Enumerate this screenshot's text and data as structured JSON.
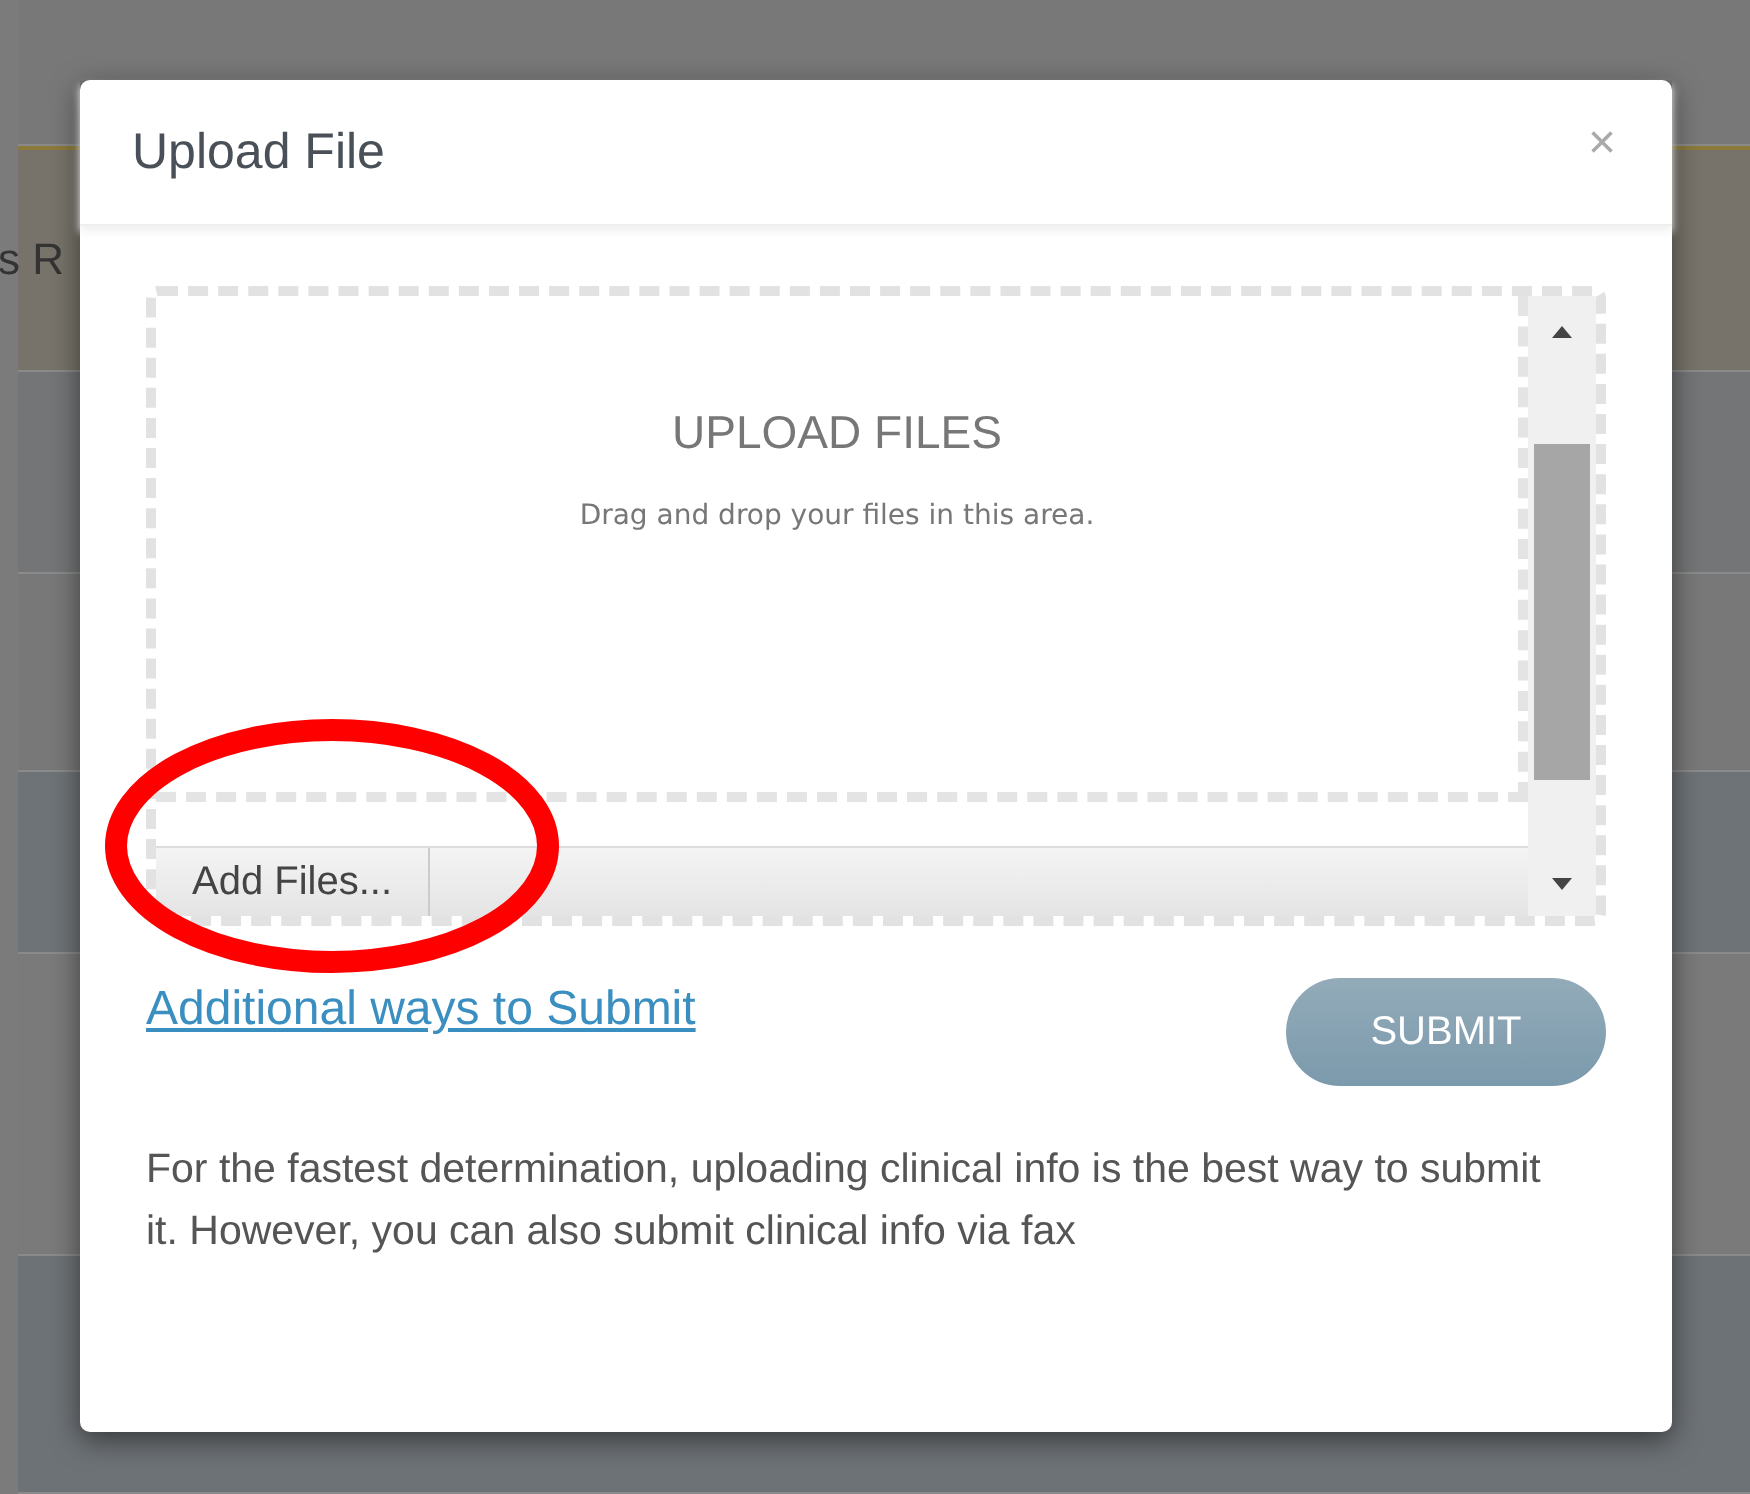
{
  "background": {
    "banner_text": "s R"
  },
  "dialog": {
    "title": "Upload File",
    "close": "×",
    "dropzone": {
      "title": "UPLOAD FILES",
      "hint": "Drag and drop your files in this area.",
      "add_button": "Add Files..."
    },
    "link": "Additional ways to Submit",
    "submit": "SUBMIT",
    "note": "For the fastest determination, uploading clinical info is the best way to submit it. However, you can also submit clinical info via fax"
  },
  "annotation": {
    "kind": "ellipse",
    "color": "#ff0000"
  }
}
